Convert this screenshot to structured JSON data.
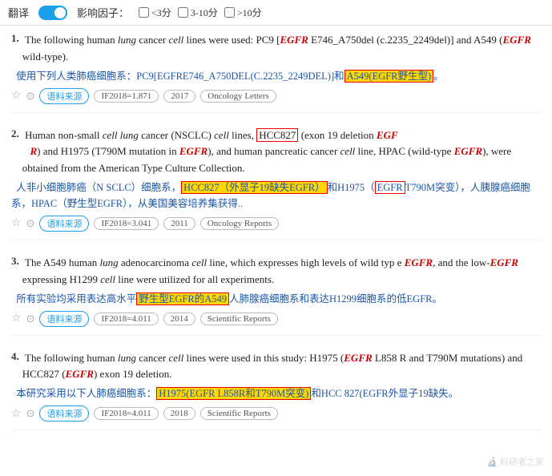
{
  "topbar": {
    "translate_label": "翻译",
    "impact_label": "影响因子：",
    "filters": [
      {
        "id": "f1",
        "label": "<3分",
        "checked": false
      },
      {
        "id": "f2",
        "label": "3-10分",
        "checked": false
      },
      {
        "id": "f3",
        "label": ">10分",
        "checked": false
      }
    ]
  },
  "results": [
    {
      "num": "1.",
      "en": "The following human {lung} cancer {cell} lines were used: PC9 [{EGFR} E746_A750del (c.2235_2249del)] and A549 ({EGFR} wild-type).",
      "cn": "使用下列人类肺癌细胞系：PC9[EGFRE746_A750DEL(C.2235_2249DEL)]和{A549(EGFR野生型)}。",
      "meta": {
        "star": "☆",
        "refresh": "⟳",
        "source_label": "语料来源",
        "if_label": "IF2018=1.871",
        "year": "2017",
        "journal": "Oncology Letters"
      }
    },
    {
      "num": "2.",
      "en": "Human non-small {cell} {lung} cancer (NSCLC) {cell} lines, {HCC827} (exon 19 deletion {EGF R}) and H1975 (T790M mutation in {EGFR}), and human pancreatic cancer {cell} line, HPAC (wild-type {EGFR}), were obtained from the American Type Culture Collection.",
      "cn": "人非小细胞肺癌（N SCLC）细胞系，{HCC827（外显子19缺失EGFR）}和H1975（EGFR T790M突变），人胰腺癌细胞系，HPAC（野生型EGFR），从美国美容培养集获得..",
      "meta": {
        "star": "☆",
        "refresh": "⟳",
        "source_label": "语料来源",
        "if_label": "IF2018=3.041",
        "year": "2011",
        "journal": "Oncology Reports"
      }
    },
    {
      "num": "3.",
      "en": "The A549 human {lung} adenocarcinoma {cell} line, which expresses high levels of wild type {EGFR}, and the low-{EGFR} expressing H1299 {cell} line were utilized for all experiments.",
      "cn": "所有实验均采用表达高水平{野生型EGFR的A549}人肺腺癌细胞系和表达H1299细胞系的低EGFR。",
      "meta": {
        "star": "☆",
        "refresh": "⟳",
        "source_label": "语料来源",
        "if_label": "IF2018=4.011",
        "year": "2014",
        "journal": "Scientific Reports"
      }
    },
    {
      "num": "4.",
      "en": "The following human {lung} cancer {cell} lines were used in this study: H1975 ({EGFR} L858R and T790M mutations) and HCC827 ({EGFR} exon 19 deletion.",
      "cn": "本研究采用以下人肺癌细胞系：{H1975(EGFR L858R和T790M突变)}和HCC 827(EGFR外显子19缺失。",
      "meta": {
        "star": "☆",
        "refresh": "⟳",
        "source_label": "语料来源",
        "if_label": "IF2018=4.011",
        "year": "2018",
        "journal": "Scientific Reports"
      }
    }
  ],
  "watermark": "科研者之家"
}
